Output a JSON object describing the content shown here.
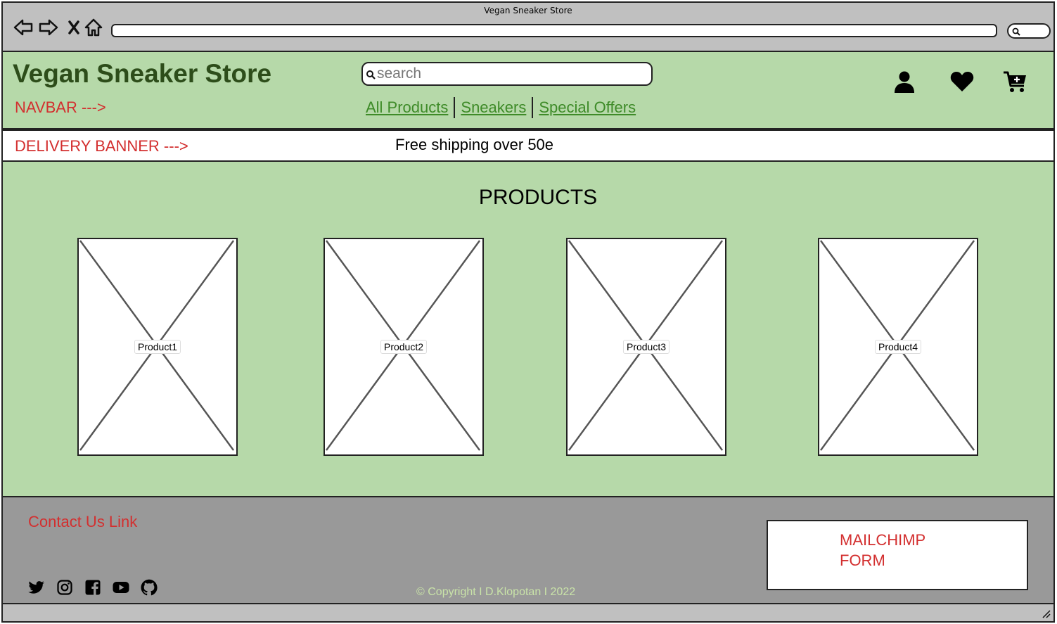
{
  "window": {
    "title": "Vegan Sneaker Store",
    "address": ""
  },
  "navbar": {
    "site_title": "Vegan Sneaker Store",
    "annotation": "NAVBAR --->",
    "search_placeholder": "search",
    "links": [
      {
        "label": "All Products"
      },
      {
        "label": "Sneakers"
      },
      {
        "label": "Special Offers"
      }
    ],
    "icons": [
      "user-icon",
      "heart-icon",
      "cart-add-icon"
    ]
  },
  "banner": {
    "annotation": "DELIVERY BANNER --->",
    "text": "Free shipping over 50e"
  },
  "main": {
    "heading": "PRODUCTS",
    "products": [
      {
        "label": "Product1"
      },
      {
        "label": "Product2"
      },
      {
        "label": "Product3"
      },
      {
        "label": "Product4"
      }
    ]
  },
  "footer": {
    "contact_link": "Contact Us Link",
    "social_icons": [
      "twitter-icon",
      "instagram-icon",
      "facebook-icon",
      "youtube-icon",
      "github-icon"
    ],
    "copyright": "© Copyright I D.Klopotan I 2022",
    "mailchimp_line1": "MAILCHIMP",
    "mailchimp_line2": "FORM"
  },
  "colors": {
    "chrome": "#c0c0c0",
    "page_green": "#b6d9a9",
    "title_green": "#2d4d1a",
    "link_green": "#3e8b28",
    "annotation_red": "#d32f2f",
    "footer_gray": "#999999",
    "copyright_green": "#c9e3a8"
  }
}
